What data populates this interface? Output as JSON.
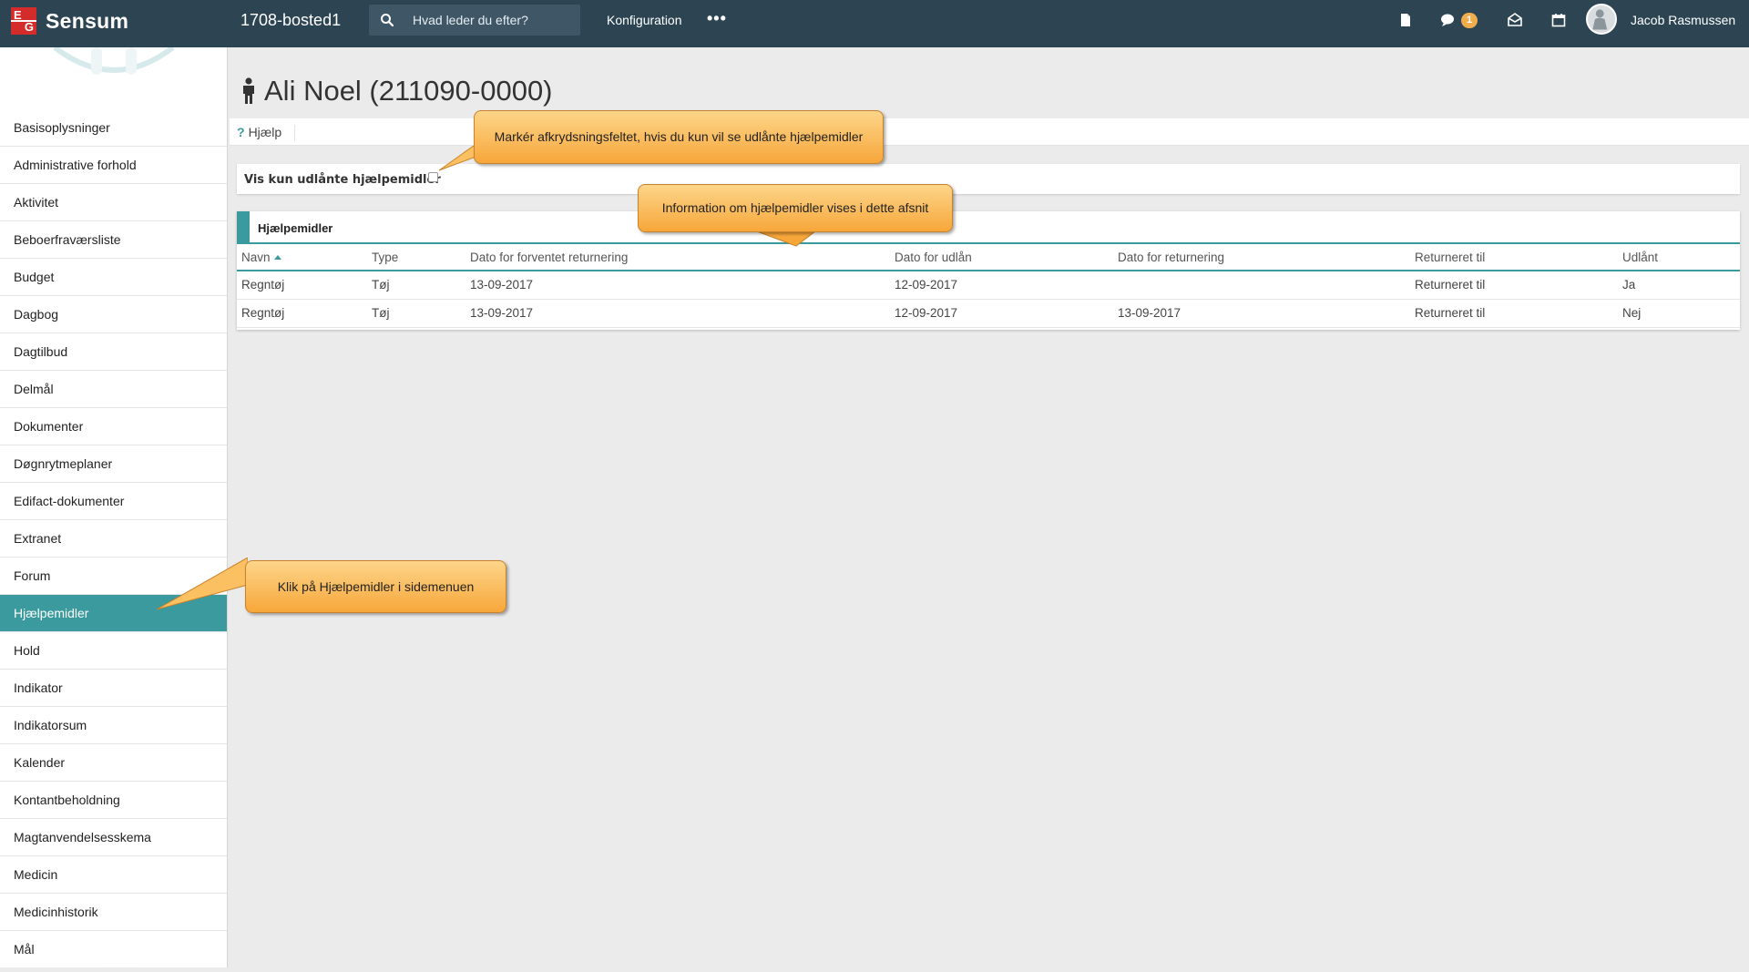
{
  "topbar": {
    "brand": "Sensum",
    "logo_e": "E",
    "logo_g": "G",
    "site": "1708-bosted1",
    "search_placeholder": "Hvad leder du efter?",
    "config_label": "Konfiguration",
    "more_label": "•••",
    "message_count": "1",
    "user_name": "Jacob Rasmussen"
  },
  "sidebar": {
    "items": [
      "Basisoplysninger",
      "Administrative forhold",
      "Aktivitet",
      "Beboerfraværsliste",
      "Budget",
      "Dagbog",
      "Dagtilbud",
      "Delmål",
      "Dokumenter",
      "Døgnrytmeplaner",
      "Edifact-dokumenter",
      "Extranet",
      "Forum",
      "Hjælpemidler",
      "Hold",
      "Indikator",
      "Indikatorsum",
      "Kalender",
      "Kontantbeholdning",
      "Magtanvendelsesskema",
      "Medicin",
      "Medicinhistorik",
      "Mål"
    ],
    "active": "Hjælpemidler"
  },
  "page": {
    "title": "Ali Noel (211090-0000)",
    "help_label": "Hjælp",
    "filter_label": "Vis kun udlånte hjælpemidler",
    "filter_checked": false
  },
  "panel": {
    "title": "Hjælpemidler",
    "columns": [
      "Navn",
      "Type",
      "Dato for forventet returnering",
      "Dato for udlån",
      "Dato for returnering",
      "Returneret til",
      "Udlånt"
    ],
    "rows": [
      [
        "Regntøj",
        "Tøj",
        "13-09-2017",
        "12-09-2017",
        "",
        "Returneret til",
        "Ja"
      ],
      [
        "Regntøj",
        "Tøj",
        "13-09-2017",
        "12-09-2017",
        "13-09-2017",
        "Returneret til",
        "Nej"
      ]
    ]
  },
  "callouts": {
    "checkbox_tip": "Markér afkrydsningsfeltet, hvis du kun vil se udlånte hjælpemidler",
    "info_tip": "Information om hjælpemidler vises i dette afsnit",
    "menu_tip": "Klik på Hjælpemidler i sidemenuen"
  },
  "colors": {
    "topbar": "#2d4553",
    "accent": "#3a9a9e",
    "callout": "#f7a73a",
    "badge": "#f0ad4e"
  },
  "icons": [
    "search-icon",
    "document-icon",
    "chat-icon",
    "mail-icon",
    "calendar-icon",
    "user-avatar-icon",
    "person-icon",
    "help-icon"
  ]
}
